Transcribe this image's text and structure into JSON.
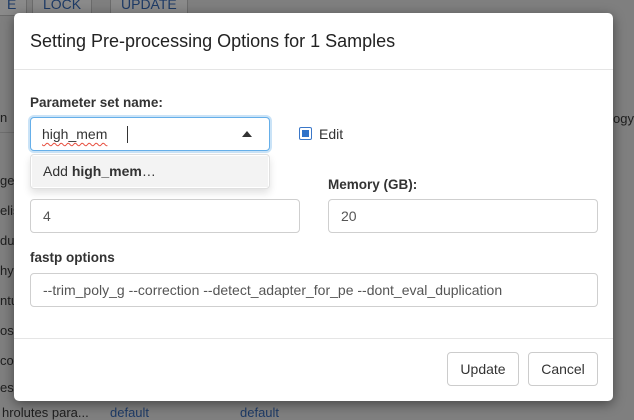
{
  "background": {
    "top_buttons": [
      "E",
      "LOCK",
      "UPDATE"
    ],
    "row_fragments": [
      "n",
      "ger",
      "elis",
      "dul",
      "hyr",
      "ntu",
      "os",
      "co",
      "es"
    ],
    "right_column_header": "ogy",
    "bottom_row": {
      "label": "hrolutes para...",
      "col2": "default",
      "col3": "default"
    }
  },
  "modal": {
    "title": "Setting Pre-processing Options for 1 Samples",
    "parameter_set": {
      "label": "Parameter set name:",
      "value": "high_mem",
      "dropdown_option_prefix": "Add ",
      "dropdown_option_value": "high_mem",
      "dropdown_option_suffix": "…"
    },
    "edit": {
      "label": "Edit",
      "checked": true
    },
    "cores_value": "4",
    "memory": {
      "label": "Memory (GB):",
      "value": "20"
    },
    "fastp": {
      "label": "fastp options",
      "value": "--trim_poly_g --correction --detect_adapter_for_pe --dont_eval_duplication"
    },
    "buttons": {
      "update": "Update",
      "cancel": "Cancel"
    }
  },
  "colors": {
    "focus_border": "#66afe9",
    "checkbox": "#2f72c9",
    "overlay": "#7f7f7f"
  }
}
